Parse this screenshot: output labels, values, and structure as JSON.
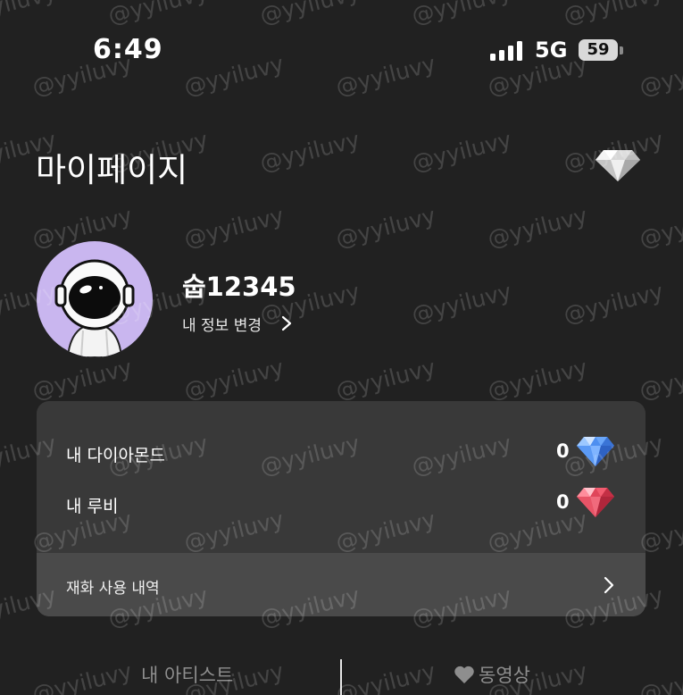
{
  "status_bar": {
    "time": "6:49",
    "network": "5G",
    "battery": "59"
  },
  "header": {
    "title": "마이페이지",
    "shop_icon": "diamond-icon"
  },
  "profile": {
    "username": "숩12345",
    "edit_label": "내 정보 변경"
  },
  "wallet": {
    "diamond": {
      "label": "내 다이아몬드",
      "count": "0",
      "icon": "blue-diamond-icon"
    },
    "ruby": {
      "label": "내 루비",
      "count": "0",
      "icon": "red-ruby-icon"
    },
    "history_label": "재화 사용 내역"
  },
  "tabs": [
    {
      "label": "내 아티스트"
    },
    {
      "label": "동영상",
      "icon": "heart-icon"
    }
  ],
  "watermark": "@yyiluvy",
  "colors": {
    "background": "#212121",
    "card": "#393939",
    "card_footer": "#4a4a4a",
    "avatar_bg": "#c9b6ef"
  }
}
